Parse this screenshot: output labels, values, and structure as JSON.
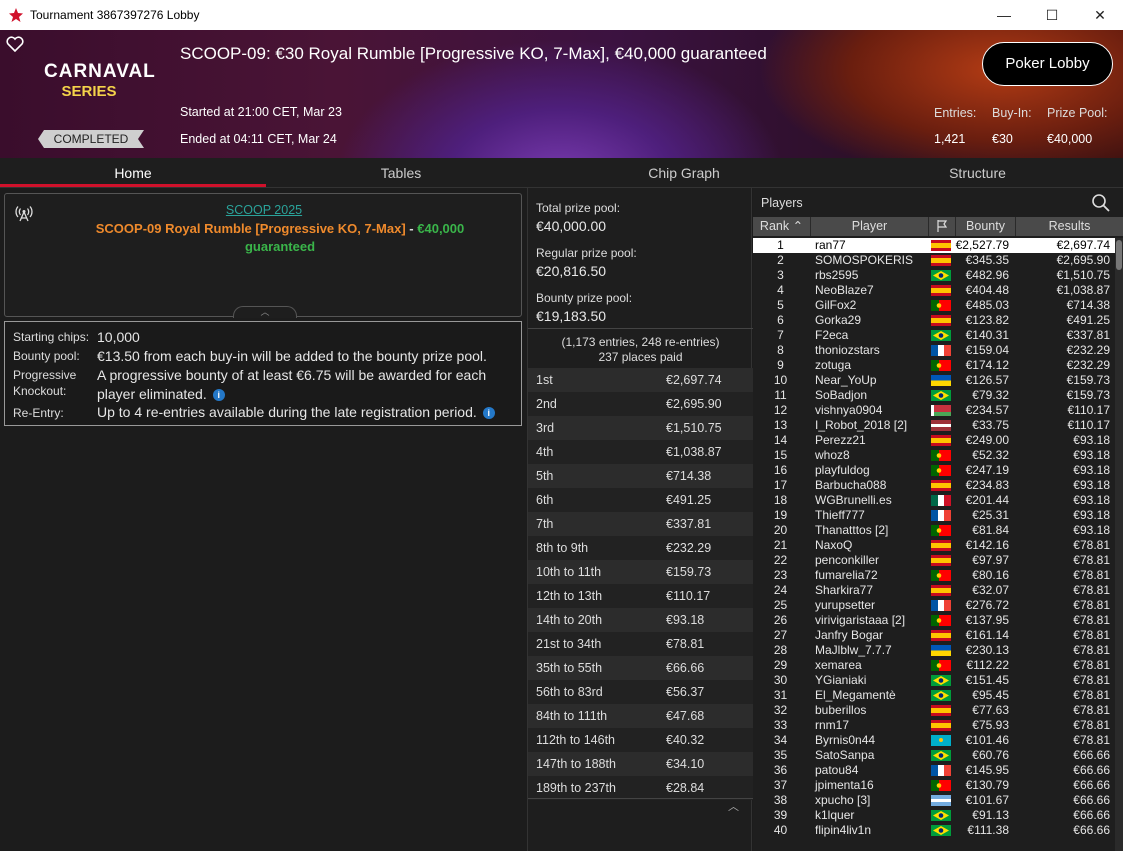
{
  "window": {
    "title": "Tournament 3867397276 Lobby",
    "minimize": "—",
    "maximize": "☐",
    "close": "✕"
  },
  "banner": {
    "logo_line1": "CARNAVAL",
    "logo_line2": "SERIES",
    "status": "COMPLETED",
    "title": "SCOOP-09: €30 Royal Rumble [Progressive KO, 7-Max], €40,000 guaranteed",
    "started": "Started at 21:00 CET, Mar 23",
    "ended": "Ended at 04:11 CET, Mar 24",
    "poker_lobby": "Poker Lobby",
    "entries_label": "Entries:",
    "entries": "1,421",
    "buyin_label": "Buy-In:",
    "buyin": "€30",
    "prize_label": "Prize Pool:",
    "prize": "€40,000"
  },
  "tabs": [
    "Home",
    "Tables",
    "Chip Graph",
    "Structure"
  ],
  "info": {
    "series_link": "SCOOP 2025",
    "name_orange": "SCOOP-09 Royal Rumble [Progressive KO, 7-Max]",
    "dash": " - ",
    "name_green_a": "€40,000",
    "name_green_b": "guaranteed"
  },
  "details": {
    "chips_label": "Starting chips:",
    "chips": "10,000",
    "bounty_label": "Bounty pool:",
    "bounty": "€13.50 from each buy-in will be added to the bounty prize pool.",
    "pko_label1": "Progressive",
    "pko_label2": "Knockout:",
    "pko1": "A progressive bounty of at least €6.75 will be awarded for each",
    "pko2": "player eliminated.",
    "reentry_label": "Re-Entry:",
    "reentry": "Up to 4 re-entries available during the late registration period."
  },
  "prizes": {
    "total_label": "Total prize pool:",
    "total": "€40,000.00",
    "regular_label": "Regular prize pool:",
    "regular": "€20,816.50",
    "bounty_label": "Bounty prize pool:",
    "bounty": "€19,183.50",
    "entries_note": "(1,173 entries, 248 re-entries)",
    "places_paid": "237 places paid"
  },
  "payouts": [
    {
      "place": "1st",
      "amount": "€2,697.74"
    },
    {
      "place": "2nd",
      "amount": "€2,695.90"
    },
    {
      "place": "3rd",
      "amount": "€1,510.75"
    },
    {
      "place": "4th",
      "amount": "€1,038.87"
    },
    {
      "place": "5th",
      "amount": "€714.38"
    },
    {
      "place": "6th",
      "amount": "€491.25"
    },
    {
      "place": "7th",
      "amount": "€337.81"
    },
    {
      "place": "8th to 9th",
      "amount": "€232.29"
    },
    {
      "place": "10th to 11th",
      "amount": "€159.73"
    },
    {
      "place": "12th to 13th",
      "amount": "€110.17"
    },
    {
      "place": "14th to 20th",
      "amount": "€93.18"
    },
    {
      "place": "21st to 34th",
      "amount": "€78.81"
    },
    {
      "place": "35th to 55th",
      "amount": "€66.66"
    },
    {
      "place": "56th to 83rd",
      "amount": "€56.37"
    },
    {
      "place": "84th to 111th",
      "amount": "€47.68"
    },
    {
      "place": "112th to 146th",
      "amount": "€40.32"
    },
    {
      "place": "147th to 188th",
      "amount": "€34.10"
    },
    {
      "place": "189th to 237th",
      "amount": "€28.84"
    }
  ],
  "players": {
    "title": "Players",
    "columns": {
      "rank": "Rank",
      "player": "Player",
      "bounty": "Bounty",
      "results": "Results"
    },
    "flag_colors": {
      "es": [
        "#c60b1e",
        "#ffc400",
        "#c60b1e"
      ],
      "br": "#009c3b",
      "fr": [
        "#0055a4",
        "#ffffff",
        "#ef4135"
      ],
      "pt": [
        "#006600",
        "#ff0000"
      ],
      "ua": [
        "#0057b7",
        "#ffd700"
      ],
      "by": [
        "#c8313e",
        "#4aa657"
      ],
      "lv": [
        "#9e3039",
        "#ffffff",
        "#9e3039"
      ],
      "kz": "#00afca",
      "ar": [
        "#74acdf",
        "#ffffff",
        "#74acdf"
      ],
      "mx": [
        "#006847",
        "#ffffff",
        "#ce1126"
      ]
    },
    "rows": [
      {
        "rank": "1",
        "name": "ran77",
        "flag": "es",
        "bounty": "€2,527.79",
        "result": "€2,697.74"
      },
      {
        "rank": "2",
        "name": "SOMOSPOKERIS",
        "flag": "es",
        "bounty": "€345.35",
        "result": "€2,695.90"
      },
      {
        "rank": "3",
        "name": "rbs2595",
        "flag": "br",
        "bounty": "€482.96",
        "result": "€1,510.75"
      },
      {
        "rank": "4",
        "name": "NeoBlaze7",
        "flag": "es",
        "bounty": "€404.48",
        "result": "€1,038.87"
      },
      {
        "rank": "5",
        "name": "GilFox2",
        "flag": "pt",
        "bounty": "€485.03",
        "result": "€714.38"
      },
      {
        "rank": "6",
        "name": "Gorka29",
        "flag": "es",
        "bounty": "€123.82",
        "result": "€491.25"
      },
      {
        "rank": "7",
        "name": "F2eca",
        "flag": "br",
        "bounty": "€140.31",
        "result": "€337.81"
      },
      {
        "rank": "8",
        "name": "thoniozstars",
        "flag": "fr",
        "bounty": "€159.04",
        "result": "€232.29"
      },
      {
        "rank": "9",
        "name": "zotuga",
        "flag": "pt",
        "bounty": "€174.12",
        "result": "€232.29"
      },
      {
        "rank": "10",
        "name": "Near_YoUp",
        "flag": "ua",
        "bounty": "€126.57",
        "result": "€159.73"
      },
      {
        "rank": "11",
        "name": "SoBadjon",
        "flag": "br",
        "bounty": "€79.32",
        "result": "€159.73"
      },
      {
        "rank": "12",
        "name": "vishnya0904",
        "flag": "by",
        "bounty": "€234.57",
        "result": "€110.17"
      },
      {
        "rank": "13",
        "name": "I_Robot_2018 [2]",
        "flag": "lv",
        "bounty": "€33.75",
        "result": "€110.17"
      },
      {
        "rank": "14",
        "name": "Perezz21",
        "flag": "es",
        "bounty": "€249.00",
        "result": "€93.18"
      },
      {
        "rank": "15",
        "name": "whoz8",
        "flag": "pt",
        "bounty": "€52.32",
        "result": "€93.18"
      },
      {
        "rank": "16",
        "name": "playfuldog",
        "flag": "pt",
        "bounty": "€247.19",
        "result": "€93.18"
      },
      {
        "rank": "17",
        "name": "Barbucha088",
        "flag": "es",
        "bounty": "€234.83",
        "result": "€93.18"
      },
      {
        "rank": "18",
        "name": "WGBrunelli.es",
        "flag": "mx",
        "bounty": "€201.44",
        "result": "€93.18"
      },
      {
        "rank": "19",
        "name": "Thieff777",
        "flag": "fr",
        "bounty": "€25.31",
        "result": "€93.18"
      },
      {
        "rank": "20",
        "name": "Thanatttos [2]",
        "flag": "pt",
        "bounty": "€81.84",
        "result": "€93.18"
      },
      {
        "rank": "21",
        "name": "NaxoQ",
        "flag": "es",
        "bounty": "€142.16",
        "result": "€78.81"
      },
      {
        "rank": "22",
        "name": "penconkiller",
        "flag": "es",
        "bounty": "€97.97",
        "result": "€78.81"
      },
      {
        "rank": "23",
        "name": "fumarelia72",
        "flag": "pt",
        "bounty": "€80.16",
        "result": "€78.81"
      },
      {
        "rank": "24",
        "name": "Sharkira77",
        "flag": "es",
        "bounty": "€32.07",
        "result": "€78.81"
      },
      {
        "rank": "25",
        "name": "yurupsetter",
        "flag": "fr",
        "bounty": "€276.72",
        "result": "€78.81"
      },
      {
        "rank": "26",
        "name": "virivigaristaaa [2]",
        "flag": "pt",
        "bounty": "€137.95",
        "result": "€78.81"
      },
      {
        "rank": "27",
        "name": "Janfry Bogar",
        "flag": "es",
        "bounty": "€161.14",
        "result": "€78.81"
      },
      {
        "rank": "28",
        "name": "MaJlblw_7.7.7",
        "flag": "ua",
        "bounty": "€230.13",
        "result": "€78.81"
      },
      {
        "rank": "29",
        "name": "xemarea",
        "flag": "pt",
        "bounty": "€112.22",
        "result": "€78.81"
      },
      {
        "rank": "30",
        "name": "YGianiaki",
        "flag": "br",
        "bounty": "€151.45",
        "result": "€78.81"
      },
      {
        "rank": "31",
        "name": "El_Megamentè",
        "flag": "br",
        "bounty": "€95.45",
        "result": "€78.81"
      },
      {
        "rank": "32",
        "name": "buberillos",
        "flag": "es",
        "bounty": "€77.63",
        "result": "€78.81"
      },
      {
        "rank": "33",
        "name": "rnm17",
        "flag": "es",
        "bounty": "€75.93",
        "result": "€78.81"
      },
      {
        "rank": "34",
        "name": "Byrnis0n44",
        "flag": "kz",
        "bounty": "€101.46",
        "result": "€78.81"
      },
      {
        "rank": "35",
        "name": "SatoSanpa",
        "flag": "br",
        "bounty": "€60.76",
        "result": "€66.66"
      },
      {
        "rank": "36",
        "name": "patou84",
        "flag": "fr",
        "bounty": "€145.95",
        "result": "€66.66"
      },
      {
        "rank": "37",
        "name": "jpimenta16",
        "flag": "pt",
        "bounty": "€130.79",
        "result": "€66.66"
      },
      {
        "rank": "38",
        "name": "xpucho [3]",
        "flag": "ar",
        "bounty": "€101.67",
        "result": "€66.66"
      },
      {
        "rank": "39",
        "name": "k1lquer",
        "flag": "br",
        "bounty": "€91.13",
        "result": "€66.66"
      },
      {
        "rank": "40",
        "name": "flipin4liv1n",
        "flag": "br",
        "bounty": "€111.38",
        "result": "€66.66"
      }
    ]
  }
}
